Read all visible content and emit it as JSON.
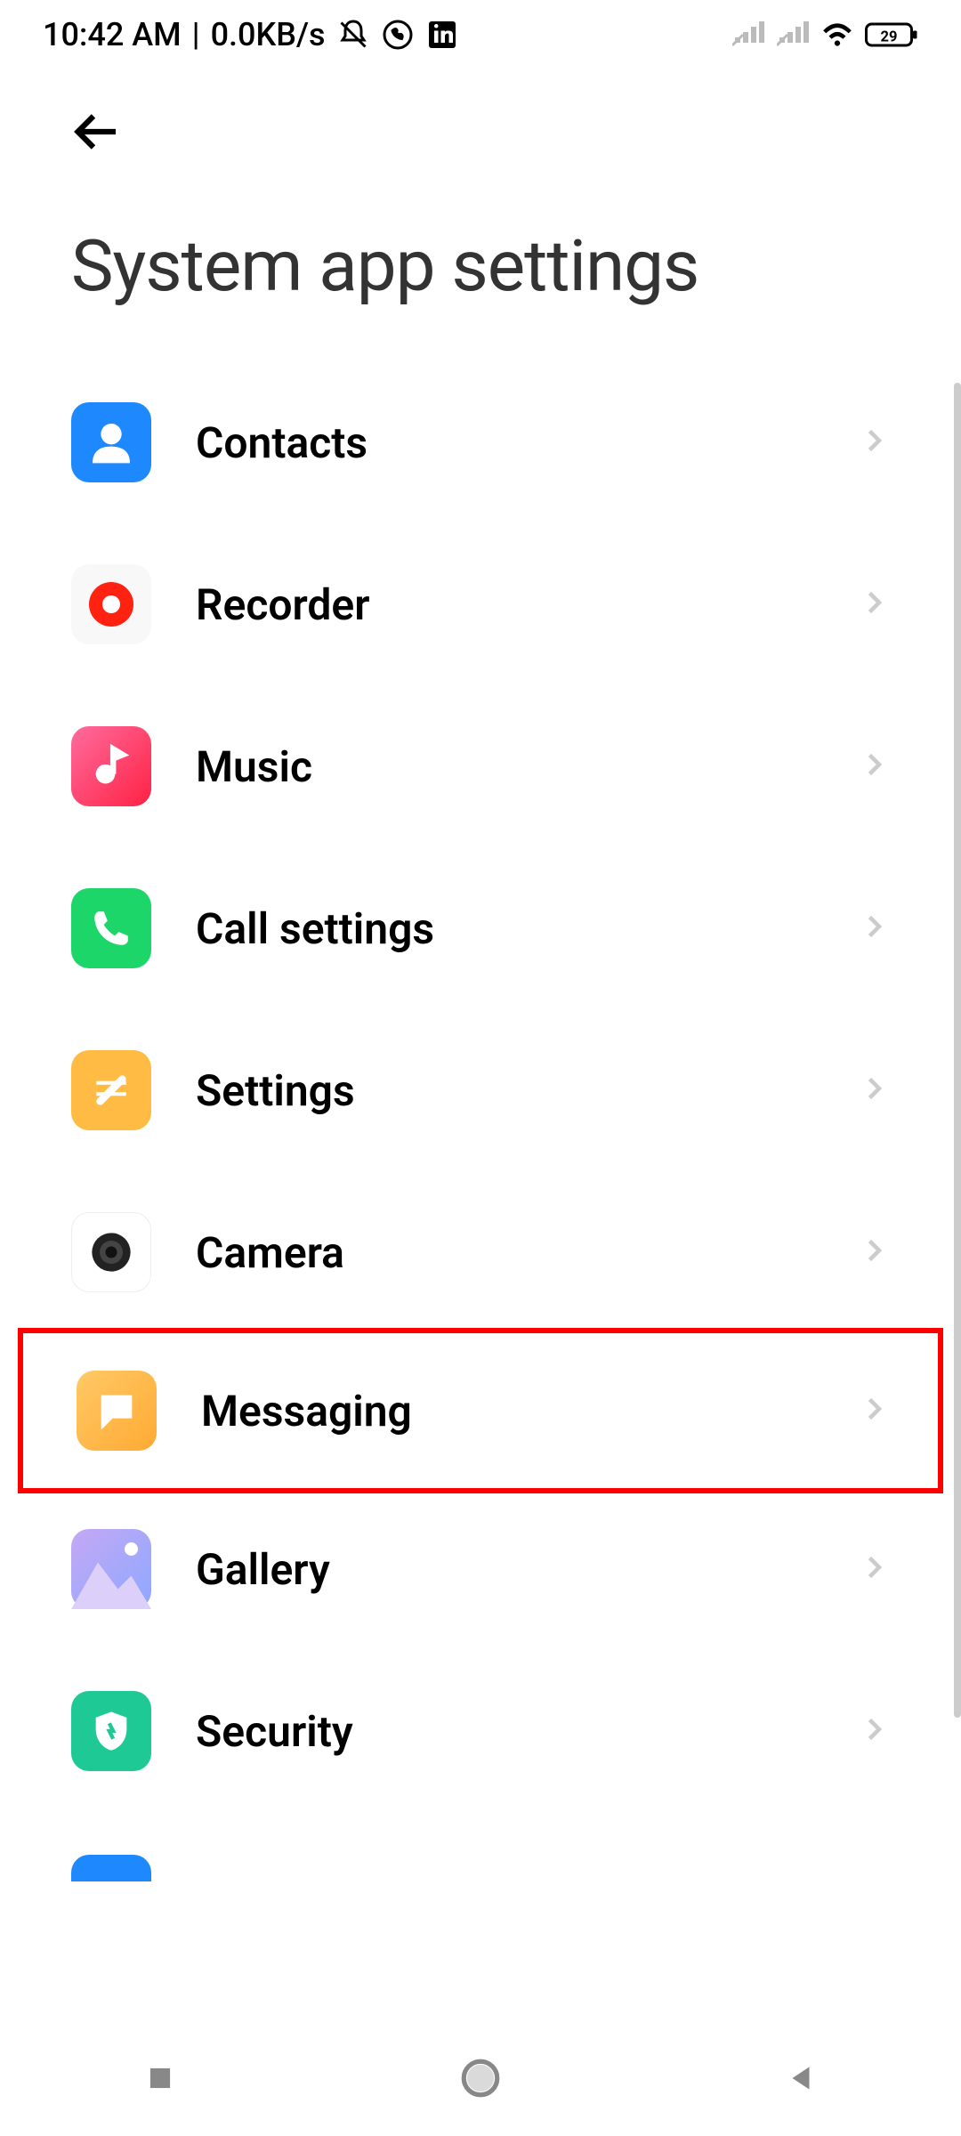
{
  "status_bar": {
    "time": "10:42 AM",
    "separator": " | ",
    "data_rate": "0.0KB/s",
    "battery_percent": "29"
  },
  "header": {
    "title": "System app settings"
  },
  "items": [
    {
      "label": "Contacts",
      "icon_name": "contacts-icon"
    },
    {
      "label": "Recorder",
      "icon_name": "recorder-icon"
    },
    {
      "label": "Music",
      "icon_name": "music-icon"
    },
    {
      "label": "Call settings",
      "icon_name": "call-settings-icon"
    },
    {
      "label": "Settings",
      "icon_name": "settings-icon"
    },
    {
      "label": "Camera",
      "icon_name": "camera-icon"
    },
    {
      "label": "Messaging",
      "icon_name": "messaging-icon",
      "highlighted": true
    },
    {
      "label": "Gallery",
      "icon_name": "gallery-icon"
    },
    {
      "label": "Security",
      "icon_name": "security-icon"
    }
  ],
  "icon_colors": {
    "contacts": "#1e88ff",
    "recorder_bg": "#f5f5f5",
    "recorder_fg": "#ff2211",
    "music_start": "#ff5599",
    "music_end": "#ff2244",
    "call": "#1dd66a",
    "settings": "#ffbb44",
    "camera_bg": "#ffffff",
    "messaging": "#ffb84d",
    "gallery_start": "#aa88ee",
    "gallery_end": "#88aaff",
    "security": "#1ec995"
  }
}
